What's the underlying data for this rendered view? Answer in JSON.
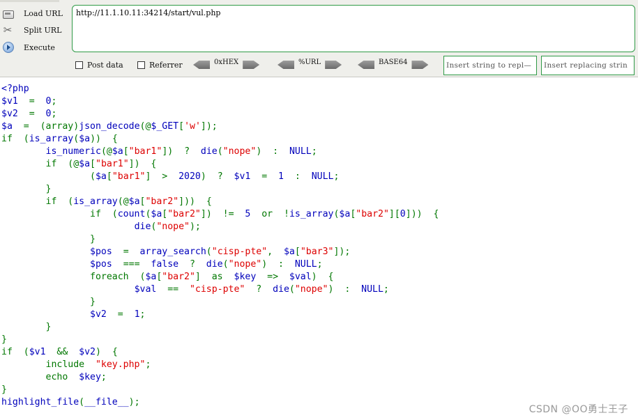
{
  "toolbar": {
    "actions": [
      {
        "label": "Load URL",
        "icon": "load-url-icon"
      },
      {
        "label": "Split URL",
        "icon": "split-url-icon"
      },
      {
        "label": "Execute",
        "icon": "execute-icon"
      }
    ],
    "url_value": "http://11.1.10.11:34214/start/vul.php",
    "post_data_label": "Post data",
    "referrer_label": "Referrer",
    "hex_label": "0xHEX",
    "url_enc_label": "%URL",
    "base64_label": "BASE64",
    "insert_search_placeholder": "Insert string to repl—",
    "insert_replace_placeholder": "Insert replacing strin",
    "accent_color": "#2f9a46"
  },
  "code": {
    "colors": {
      "keyword": "#0000bb",
      "syntax": "#007700",
      "string": "#dd0000"
    },
    "lines": [
      [
        [
          "k",
          "<?php"
        ]
      ],
      [
        [
          "k",
          "$v1"
        ],
        [
          "g",
          "  =  "
        ],
        [
          "k",
          "0"
        ],
        [
          "g",
          ";"
        ]
      ],
      [
        [
          "k",
          "$v2"
        ],
        [
          "g",
          "  =  "
        ],
        [
          "k",
          "0"
        ],
        [
          "g",
          ";"
        ]
      ],
      [
        [
          "k",
          "$a"
        ],
        [
          "g",
          "  =  (array)"
        ],
        [
          "k",
          "json_decode"
        ],
        [
          "g",
          "(@"
        ],
        [
          "k",
          "$_GET"
        ],
        [
          "g",
          "["
        ],
        [
          "s",
          "'w'"
        ],
        [
          "g",
          "]);"
        ]
      ],
      [
        [
          "g",
          "if  ("
        ],
        [
          "k",
          "is_array"
        ],
        [
          "g",
          "("
        ],
        [
          "k",
          "$a"
        ],
        [
          "g",
          "))  {"
        ]
      ],
      [
        [
          "g",
          "        "
        ],
        [
          "k",
          "is_numeric"
        ],
        [
          "g",
          "(@"
        ],
        [
          "k",
          "$a"
        ],
        [
          "g",
          "["
        ],
        [
          "s",
          "\"bar1\""
        ],
        [
          "g",
          "])  ?  "
        ],
        [
          "k",
          "die"
        ],
        [
          "g",
          "("
        ],
        [
          "s",
          "\"nope\""
        ],
        [
          "g",
          ")  :  "
        ],
        [
          "k",
          "NULL"
        ],
        [
          "g",
          ";"
        ]
      ],
      [
        [
          "g",
          "        if  (@"
        ],
        [
          "k",
          "$a"
        ],
        [
          "g",
          "["
        ],
        [
          "s",
          "\"bar1\""
        ],
        [
          "g",
          "])  {"
        ]
      ],
      [
        [
          "g",
          "                ("
        ],
        [
          "k",
          "$a"
        ],
        [
          "g",
          "["
        ],
        [
          "s",
          "\"bar1\""
        ],
        [
          "g",
          "]  >  "
        ],
        [
          "k",
          "2020"
        ],
        [
          "g",
          ")  ?  "
        ],
        [
          "k",
          "$v1"
        ],
        [
          "g",
          "  =  "
        ],
        [
          "k",
          "1"
        ],
        [
          "g",
          "  :  "
        ],
        [
          "k",
          "NULL"
        ],
        [
          "g",
          ";"
        ]
      ],
      [
        [
          "g",
          "        }"
        ]
      ],
      [
        [
          "g",
          "        if  ("
        ],
        [
          "k",
          "is_array"
        ],
        [
          "g",
          "(@"
        ],
        [
          "k",
          "$a"
        ],
        [
          "g",
          "["
        ],
        [
          "s",
          "\"bar2\""
        ],
        [
          "g",
          "]))  {"
        ]
      ],
      [
        [
          "g",
          "                if  ("
        ],
        [
          "k",
          "count"
        ],
        [
          "g",
          "("
        ],
        [
          "k",
          "$a"
        ],
        [
          "g",
          "["
        ],
        [
          "s",
          "\"bar2\""
        ],
        [
          "g",
          "])  !=  "
        ],
        [
          "k",
          "5"
        ],
        [
          "g",
          "  or  !"
        ],
        [
          "k",
          "is_array"
        ],
        [
          "g",
          "("
        ],
        [
          "k",
          "$a"
        ],
        [
          "g",
          "["
        ],
        [
          "s",
          "\"bar2\""
        ],
        [
          "g",
          "]["
        ],
        [
          "k",
          "0"
        ],
        [
          "g",
          "]))  {"
        ]
      ],
      [
        [
          "g",
          "                        "
        ],
        [
          "k",
          "die"
        ],
        [
          "g",
          "("
        ],
        [
          "s",
          "\"nope\""
        ],
        [
          "g",
          ");"
        ]
      ],
      [
        [
          "g",
          "                }"
        ]
      ],
      [
        [
          "g",
          "                "
        ],
        [
          "k",
          "$pos"
        ],
        [
          "g",
          "  =  "
        ],
        [
          "k",
          "array_search"
        ],
        [
          "g",
          "("
        ],
        [
          "s",
          "\"cisp-pte\""
        ],
        [
          "g",
          ",  "
        ],
        [
          "k",
          "$a"
        ],
        [
          "g",
          "["
        ],
        [
          "s",
          "\"bar3\""
        ],
        [
          "g",
          "]);"
        ]
      ],
      [
        [
          "g",
          "                "
        ],
        [
          "k",
          "$pos"
        ],
        [
          "g",
          "  ===  "
        ],
        [
          "k",
          "false"
        ],
        [
          "g",
          "  ?  "
        ],
        [
          "k",
          "die"
        ],
        [
          "g",
          "("
        ],
        [
          "s",
          "\"nope\""
        ],
        [
          "g",
          ")  :  "
        ],
        [
          "k",
          "NULL"
        ],
        [
          "g",
          ";"
        ]
      ],
      [
        [
          "g",
          "                foreach  ("
        ],
        [
          "k",
          "$a"
        ],
        [
          "g",
          "["
        ],
        [
          "s",
          "\"bar2\""
        ],
        [
          "g",
          "]  as  "
        ],
        [
          "k",
          "$key"
        ],
        [
          "g",
          "  =>  "
        ],
        [
          "k",
          "$val"
        ],
        [
          "g",
          ")  {"
        ]
      ],
      [
        [
          "g",
          "                        "
        ],
        [
          "k",
          "$val"
        ],
        [
          "g",
          "  ==  "
        ],
        [
          "s",
          "\"cisp-pte\""
        ],
        [
          "g",
          "  ?  "
        ],
        [
          "k",
          "die"
        ],
        [
          "g",
          "("
        ],
        [
          "s",
          "\"nope\""
        ],
        [
          "g",
          ")  :  "
        ],
        [
          "k",
          "NULL"
        ],
        [
          "g",
          ";"
        ]
      ],
      [
        [
          "g",
          "                }"
        ]
      ],
      [
        [
          "g",
          "                "
        ],
        [
          "k",
          "$v2"
        ],
        [
          "g",
          "  =  "
        ],
        [
          "k",
          "1"
        ],
        [
          "g",
          ";"
        ]
      ],
      [
        [
          "g",
          "        }"
        ]
      ],
      [
        [
          "g",
          "}"
        ]
      ],
      [
        [
          "g",
          "if  ("
        ],
        [
          "k",
          "$v1"
        ],
        [
          "g",
          "  &&  "
        ],
        [
          "k",
          "$v2"
        ],
        [
          "g",
          ")  {"
        ]
      ],
      [
        [
          "g",
          "        include  "
        ],
        [
          "s",
          "\"key.php\""
        ],
        [
          "g",
          ";"
        ]
      ],
      [
        [
          "g",
          "        echo  "
        ],
        [
          "k",
          "$key"
        ],
        [
          "g",
          ";"
        ]
      ],
      [
        [
          "g",
          "}"
        ]
      ],
      [
        [
          "k",
          "highlight_file"
        ],
        [
          "g",
          "("
        ],
        [
          "k",
          "__file__"
        ],
        [
          "g",
          ");"
        ]
      ]
    ]
  },
  "watermark": "CSDN @OO勇士王子"
}
